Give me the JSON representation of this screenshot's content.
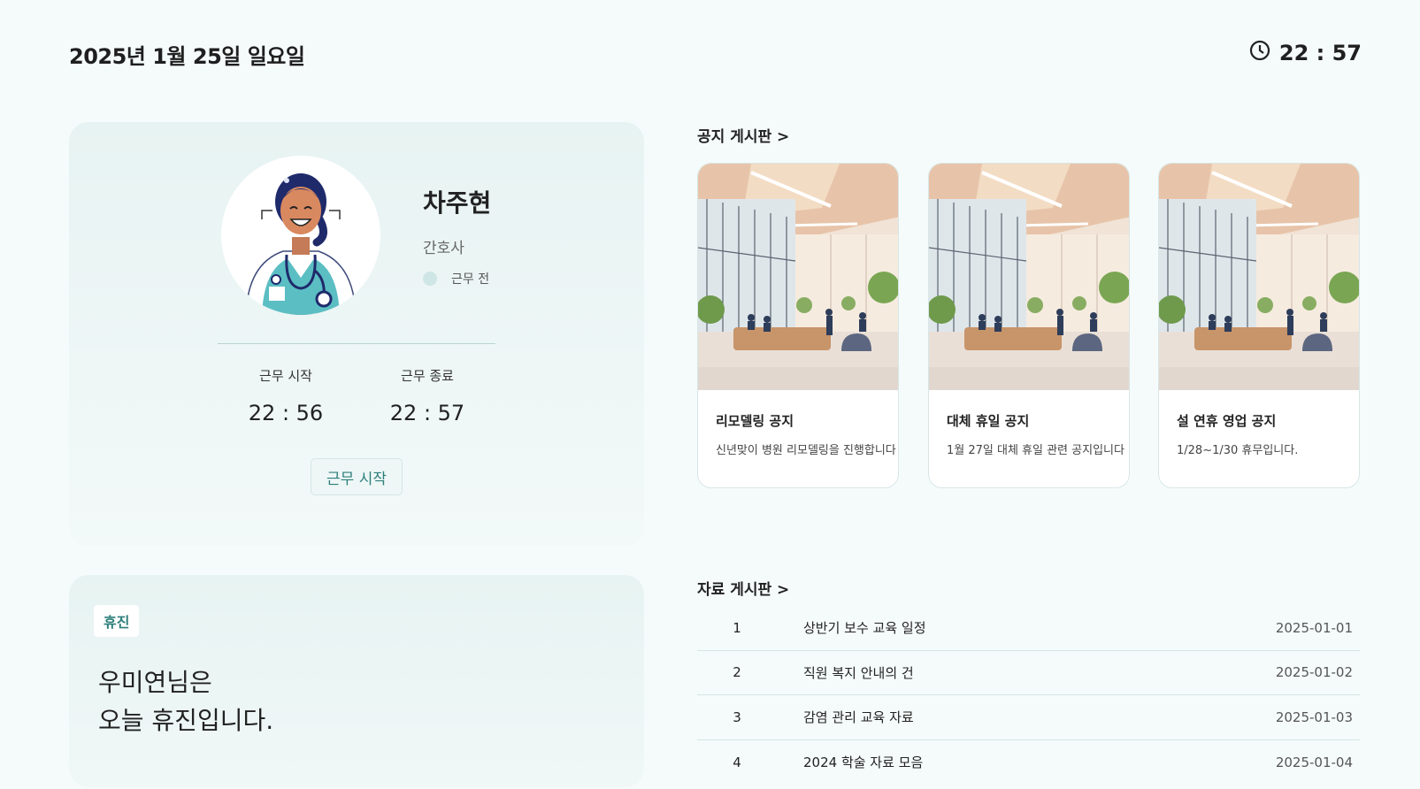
{
  "header": {
    "date": "2025년 1월 25일 일요일",
    "time": "22 : 57"
  },
  "profile": {
    "name": "차주현",
    "role": "간호사",
    "status": "근무 전",
    "work_start_label": "근무 시작",
    "work_start_time": "22 : 56",
    "work_end_label": "근무 종료",
    "work_end_time": "22 : 57",
    "button_label": "근무 시작"
  },
  "day_off": {
    "badge": "휴진",
    "line1": "우미연님은",
    "line2": "오늘 휴진입니다."
  },
  "notice_board": {
    "title": "공지 게시판 >",
    "items": [
      {
        "title": "리모델링 공지",
        "desc": "신년맞이 병원 리모델링을 진행합니다"
      },
      {
        "title": "대체 휴일 공지",
        "desc": "1월 27일 대체 휴일 관련 공지입니다"
      },
      {
        "title": "설 연휴 영업 공지",
        "desc": "1/28~1/30 휴무입니다."
      }
    ]
  },
  "data_board": {
    "title": "자료 게시판 >",
    "rows": [
      {
        "num": "1",
        "subject": "상반기 보수 교육 일정",
        "date": "2025-01-01"
      },
      {
        "num": "2",
        "subject": "직원 복지 안내의 건",
        "date": "2025-01-02"
      },
      {
        "num": "3",
        "subject": "감염 관리 교육 자료",
        "date": "2025-01-03"
      },
      {
        "num": "4",
        "subject": "2024 학술 자료 모음",
        "date": "2025-01-04"
      }
    ]
  },
  "colors": {
    "background": "#f5fbfb",
    "card": "#e7f3f2",
    "accent": "#2e7f7c",
    "status_dot": "#cfe6e6"
  },
  "icons": [
    "clock-icon",
    "nurse-avatar",
    "lobby-image"
  ]
}
